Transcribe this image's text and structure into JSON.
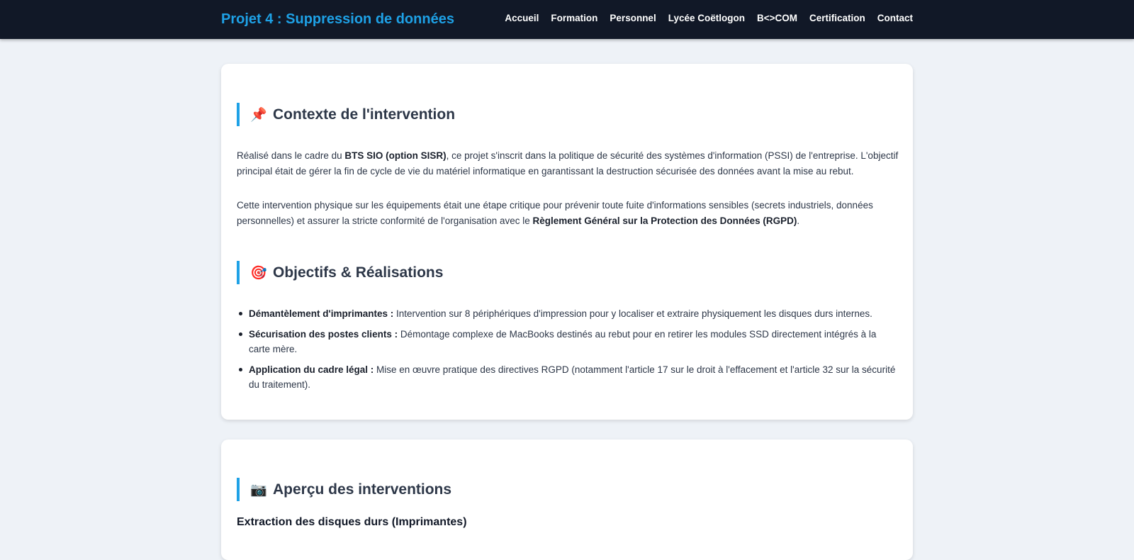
{
  "header": {
    "title": "Projet 4 : Suppression de données",
    "nav": [
      "Accueil",
      "Formation",
      "Personnel",
      "Lycée Coëtlogon",
      "B<>COM",
      "Certification",
      "Contact"
    ]
  },
  "context": {
    "icon": "pushpin-icon",
    "heading": "Contexte de l'intervention",
    "p1_a": "Réalisé dans le cadre du ",
    "p1_b": "BTS SIO (option SISR)",
    "p1_c": ", ce projet s'inscrit dans la politique de sécurité des systèmes d'information (PSSI) de l'entreprise. L'objectif principal était de gérer la fin de cycle de vie du matériel informatique en garantissant la destruction sécurisée des données avant la mise au rebut.",
    "p2_a": "Cette intervention physique sur les équipements était une étape critique pour prévenir toute fuite d'informations sensibles (secrets industriels, données personnelles) et assurer la stricte conformité de l'organisation avec le ",
    "p2_b": "Règlement Général sur la Protection des Données (RGPD)",
    "p2_c": "."
  },
  "objectives": {
    "icon": "target-icon",
    "heading": "Objectifs & Réalisations",
    "items": [
      {
        "label": "Démantèlement d'imprimantes :",
        "text": " Intervention sur 8 périphériques d'impression pour y localiser et extraire physiquement les disques durs internes."
      },
      {
        "label": "Sécurisation des postes clients :",
        "text": " Démontage complexe de MacBooks destinés au rebut pour en retirer les modules SSD directement intégrés à la carte mère."
      },
      {
        "label": "Application du cadre légal :",
        "text": " Mise en œuvre pratique des directives RGPD (notamment l'article 17 sur le droit à l'effacement et l'article 32 sur la sécurité du traitement)."
      }
    ]
  },
  "overview": {
    "icon": "camera-icon",
    "heading": "Aperçu des interventions",
    "subheading": "Extraction des disques durs (Imprimantes)"
  }
}
